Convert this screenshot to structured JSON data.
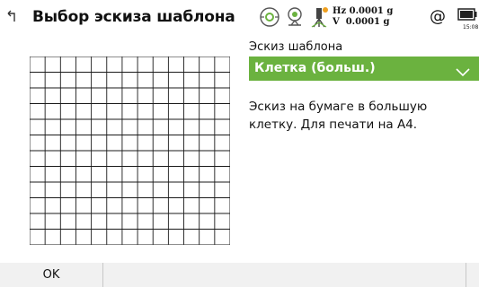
{
  "header": {
    "title": "Выбор эскиза шаблона",
    "hz": "Hz 0.0001 g",
    "v": "V  0.0001 g",
    "time": "15:08",
    "icons": [
      "back-icon",
      "target-icon",
      "prism-icon",
      "instrument-icon",
      "at-icon",
      "battery-icon"
    ]
  },
  "template": {
    "label": "Эскиз шаблона",
    "selected": "Клетка (больш.)",
    "description": "Эскиз на бумаге в большую клетку. Для печати на A4."
  },
  "footer": {
    "ok_label": "OK"
  },
  "colors": {
    "accent": "#6bb23f",
    "battery_level": "#222222",
    "warning_dot": "#f0a020"
  }
}
